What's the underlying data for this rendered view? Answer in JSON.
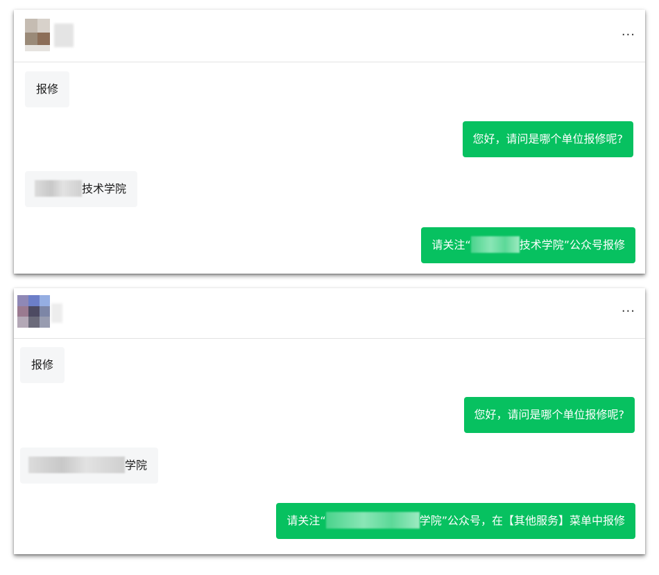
{
  "chats": [
    {
      "more_label": "···",
      "messages": [
        {
          "role": "user",
          "text": "报修"
        },
        {
          "role": "agent",
          "text": "您好，请问是哪个单位报修呢?"
        },
        {
          "role": "user",
          "text_suffix": "技术学院"
        },
        {
          "role": "agent",
          "text_prefix": "请关注“",
          "text_suffix": "技术学院”公众号报修"
        }
      ]
    },
    {
      "more_label": "···",
      "messages": [
        {
          "role": "user",
          "text": "报修"
        },
        {
          "role": "agent",
          "text": "您好，请问是哪个单位报修呢?"
        },
        {
          "role": "user",
          "text_suffix": "学院"
        },
        {
          "role": "agent",
          "text_prefix": "请关注“",
          "text_suffix": "学院”公众号，在【其他服务】菜单中报修"
        }
      ]
    }
  ],
  "colors": {
    "agent_bubble": "#07c160",
    "user_bubble": "#f5f6f7",
    "divider": "#e2e2e2"
  }
}
